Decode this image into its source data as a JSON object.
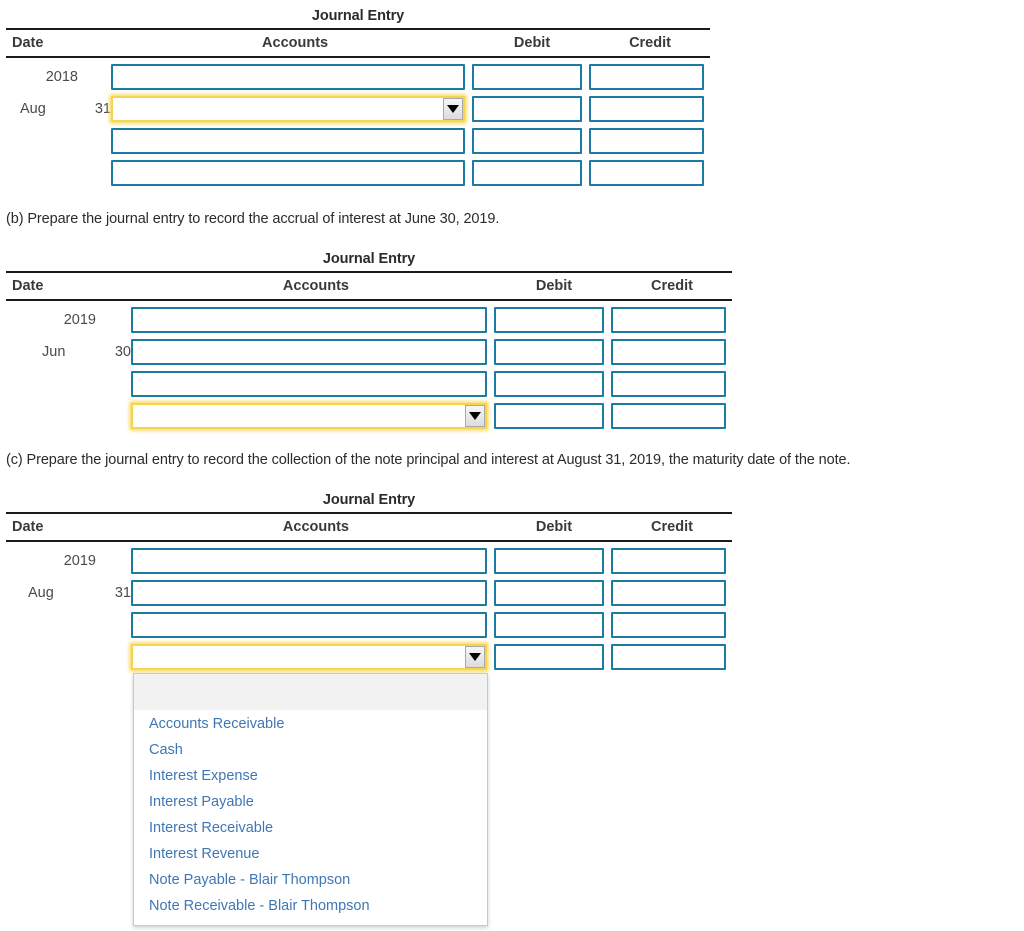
{
  "sections": [
    {
      "id": "a",
      "prompt": null,
      "table": {
        "title": "Journal Entry",
        "columns": [
          "Date",
          "Accounts",
          "Debit",
          "Credit"
        ],
        "date_lines": [
          {
            "year": "2018",
            "month": "",
            "day": ""
          },
          {
            "year": "",
            "month": "Aug",
            "day": "31"
          },
          {
            "year": "",
            "month": "",
            "day": ""
          },
          {
            "year": "",
            "month": "",
            "day": ""
          }
        ],
        "rows": [
          {
            "account": "",
            "account_type": "text",
            "focused": false,
            "debit": "",
            "credit": ""
          },
          {
            "account": "",
            "account_type": "select",
            "focused": true,
            "debit": "",
            "credit": ""
          },
          {
            "account": "",
            "account_type": "text",
            "focused": false,
            "debit": "",
            "credit": ""
          },
          {
            "account": "",
            "account_type": "text",
            "focused": false,
            "debit": "",
            "credit": ""
          }
        ]
      }
    },
    {
      "id": "b",
      "prompt": "(b) Prepare the journal entry to record the accrual of interest at June 30, 2019.",
      "table": {
        "title": "Journal Entry",
        "columns": [
          "Date",
          "Accounts",
          "Debit",
          "Credit"
        ],
        "date_lines": [
          {
            "year": "2019",
            "month": "",
            "day": ""
          },
          {
            "year": "",
            "month": "Jun",
            "day": "30"
          },
          {
            "year": "",
            "month": "",
            "day": ""
          },
          {
            "year": "",
            "month": "",
            "day": ""
          }
        ],
        "rows": [
          {
            "account": "",
            "account_type": "text",
            "focused": false,
            "debit": "",
            "credit": ""
          },
          {
            "account": "",
            "account_type": "text",
            "focused": false,
            "debit": "",
            "credit": ""
          },
          {
            "account": "",
            "account_type": "text",
            "focused": false,
            "debit": "",
            "credit": ""
          },
          {
            "account": "",
            "account_type": "select",
            "focused": true,
            "debit": "",
            "credit": ""
          }
        ]
      }
    },
    {
      "id": "c",
      "prompt": "(c) Prepare the journal entry to record the collection of the note principal and interest at August 31, 2019, the maturity date of the note.",
      "table": {
        "title": "Journal Entry",
        "columns": [
          "Date",
          "Accounts",
          "Debit",
          "Credit"
        ],
        "date_lines": [
          {
            "year": "2019",
            "month": "",
            "day": ""
          },
          {
            "year": "",
            "month": "Aug",
            "day": "31"
          },
          {
            "year": "",
            "month": "",
            "day": ""
          },
          {
            "year": "",
            "month": "",
            "day": ""
          }
        ],
        "rows": [
          {
            "account": "",
            "account_type": "text",
            "focused": false,
            "debit": "",
            "credit": ""
          },
          {
            "account": "",
            "account_type": "text",
            "focused": false,
            "debit": "",
            "credit": ""
          },
          {
            "account": "",
            "account_type": "text",
            "focused": false,
            "debit": "",
            "credit": ""
          },
          {
            "account": "",
            "account_type": "select",
            "focused": true,
            "debit": "",
            "credit": "",
            "dropdown_open": true
          }
        ]
      }
    }
  ],
  "dropdown": {
    "blank_option": "",
    "options": [
      "Accounts Receivable",
      "Cash",
      "Interest Expense",
      "Interest Payable",
      "Interest Receivable",
      "Interest Revenue",
      "Note Payable - Blair Thompson",
      "Note Receivable - Blair Thompson"
    ]
  },
  "colors": {
    "field_border": "#1c7ba3",
    "focus_border": "#f5d54f",
    "option_text": "#3f77b4",
    "rule": "#1a1a1a",
    "blank_option_bg": "#f2f2f2"
  },
  "labels": {
    "select_arrow": "chevron-down-icon"
  }
}
